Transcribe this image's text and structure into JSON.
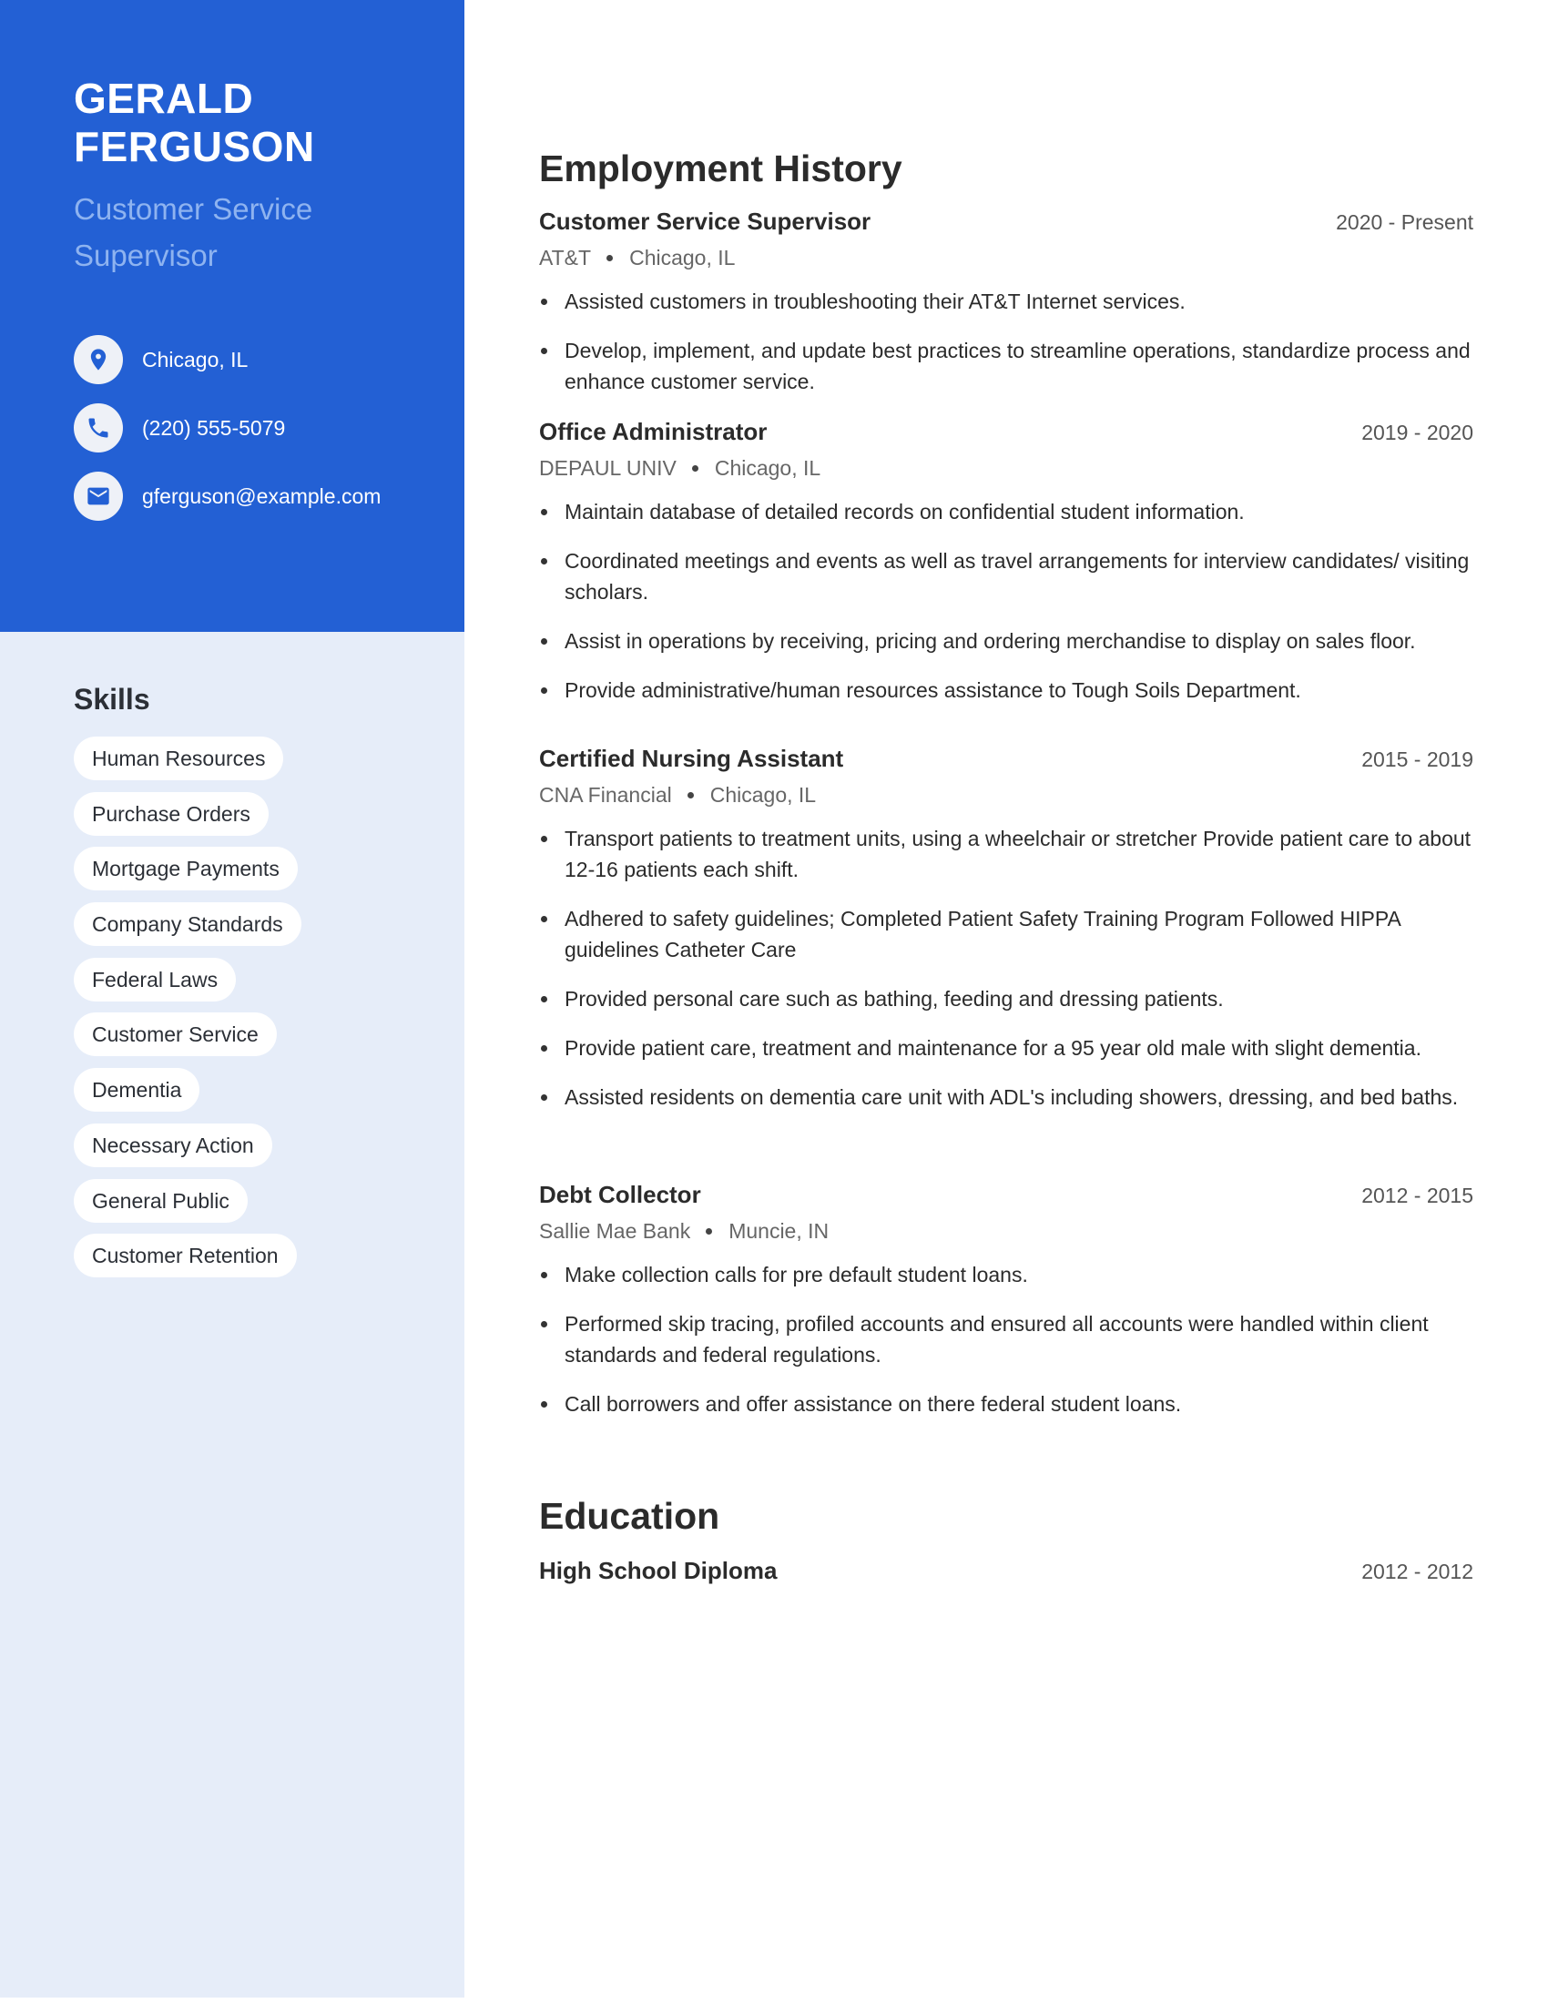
{
  "profile": {
    "first_name": "GERALD",
    "last_name": "FERGUSON",
    "title": "Customer Service Supervisor",
    "contacts": [
      {
        "icon": "location-pin-icon",
        "text": "Chicago, IL"
      },
      {
        "icon": "phone-icon",
        "text": "(220) 555-5079"
      },
      {
        "icon": "email-icon",
        "text": "gferguson@example.com"
      }
    ]
  },
  "skills": {
    "heading": "Skills",
    "items": [
      "Human Resources",
      "Purchase Orders",
      "Mortgage Payments",
      "Company Standards",
      "Federal Laws",
      "Customer Service",
      "Dementia",
      "Necessary Action",
      "General Public",
      "Customer Retention"
    ]
  },
  "employment": {
    "heading": "Employment History",
    "jobs": [
      {
        "role": "Customer Service Supervisor",
        "dates": "2020 - Present",
        "company": "AT&T",
        "location": "Chicago, IL",
        "bullets": [
          "Assisted customers in troubleshooting their AT&T Internet services.",
          "Develop, implement, and update best practices to streamline operations, standardize process and enhance customer service."
        ]
      },
      {
        "role": "Office Administrator",
        "dates": "2019 - 2020",
        "company": "DEPAUL UNIV",
        "location": "Chicago, IL",
        "bullets": [
          "Maintain database of detailed records on confidential student information.",
          "Coordinated meetings and events as well as travel arrangements for interview candidates/ visiting scholars.",
          "Assist in operations by receiving, pricing and ordering merchandise to display on sales floor.",
          "Provide administrative/human resources assistance to Tough Soils Department."
        ]
      },
      {
        "role": "Certified Nursing Assistant",
        "dates": "2015 - 2019",
        "company": "CNA Financial",
        "location": "Chicago, IL",
        "bullets": [
          "Transport patients to treatment units, using a wheelchair or stretcher Provide patient care to about 12-16 patients each shift.",
          "Adhered to safety guidelines; Completed Patient Safety Training Program Followed HIPPA guidelines Catheter Care",
          "Provided personal care such as bathing, feeding and dressing patients.",
          "Provide patient care, treatment and maintenance for a 95 year old male with slight dementia.",
          "Assisted residents on dementia care unit with ADL's including showers, dressing, and bed baths."
        ]
      },
      {
        "role": "Debt Collector",
        "dates": "2012 - 2015",
        "company": "Sallie Mae Bank",
        "location": "Muncie, IN",
        "bullets": [
          "Make collection calls for pre default student loans.",
          "Performed skip tracing, profiled accounts and ensured all accounts were handled within client standards and federal regulations.",
          "Call borrowers and offer assistance on there federal student loans."
        ]
      }
    ]
  },
  "education": {
    "heading": "Education",
    "entries": [
      {
        "degree": "High School Diploma",
        "dates": "2012 - 2012"
      }
    ]
  },
  "colors": {
    "accent_blue": "#2360d4",
    "sidebar_light": "#e6edf9",
    "subtitle_blue": "#8eb3f0"
  }
}
